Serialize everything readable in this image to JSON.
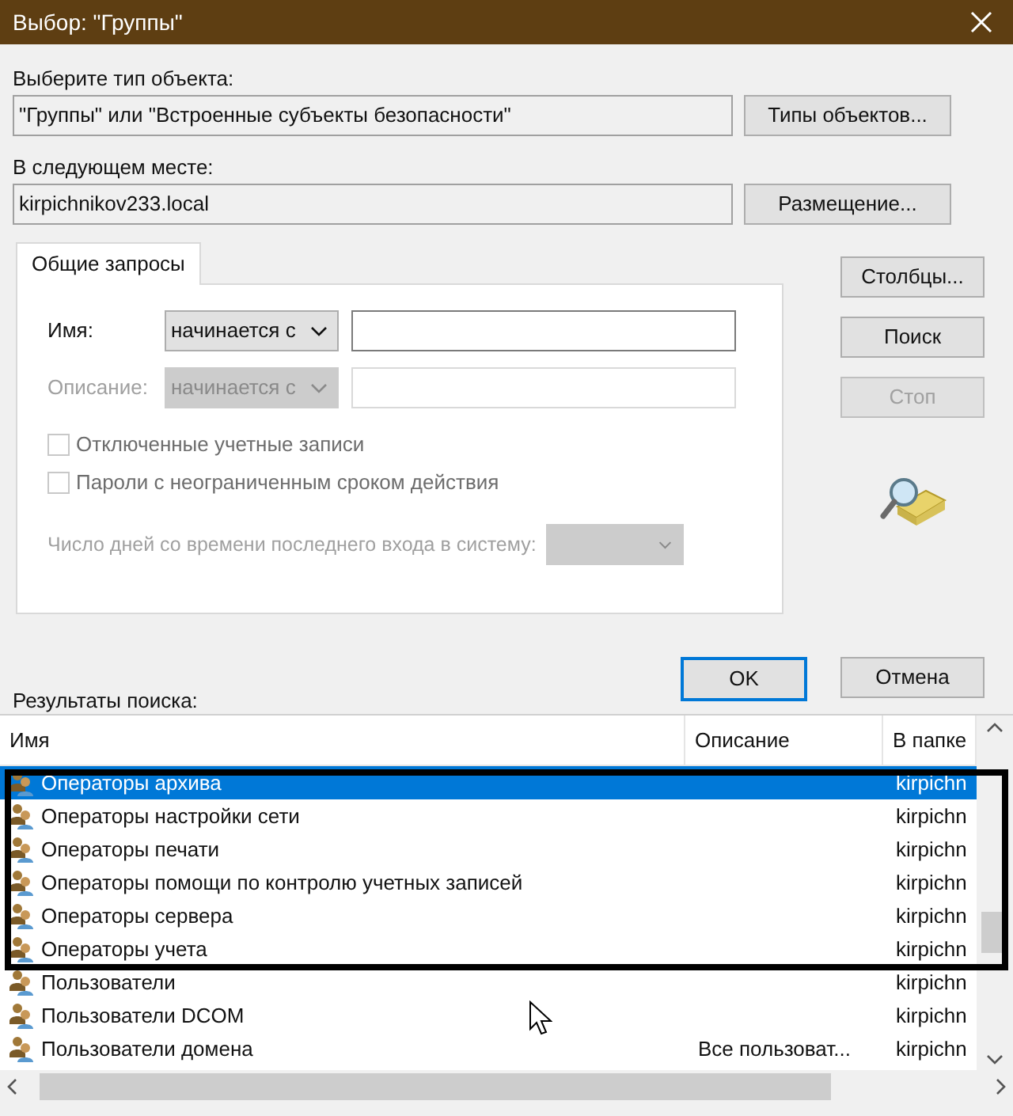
{
  "window": {
    "title": "Выбор: \"Группы\""
  },
  "object_type": {
    "label": "Выберите тип объекта:",
    "value": "\"Группы\" или \"Встроенные субъекты безопасности\"",
    "button": "Типы объектов..."
  },
  "location": {
    "label": "В следующем месте:",
    "value": "kirpichnikov233.local",
    "button": "Размещение..."
  },
  "tabs": [
    {
      "label": "Общие запросы",
      "selected": true
    }
  ],
  "query": {
    "name_label": "Имя:",
    "name_mode": "начинается с",
    "name_disabled": false,
    "description_label": "Описание:",
    "description_mode": "начинается с",
    "description_disabled": true,
    "checkboxes": [
      {
        "label": "Отключенные учетные записи",
        "checked": false,
        "disabled": true
      },
      {
        "label": "Пароли с неограниченным сроком действия",
        "checked": false,
        "disabled": true
      }
    ],
    "days_label": "Число дней со времени последнего входа в систему:"
  },
  "side_buttons": [
    {
      "label": "Столбцы...",
      "disabled": false
    },
    {
      "label": "Поиск",
      "disabled": false
    },
    {
      "label": "Стоп",
      "disabled": true
    }
  ],
  "buttons": [
    {
      "label": "OK",
      "default": true
    },
    {
      "label": "Отмена",
      "default": false
    }
  ],
  "results": {
    "label": "Результаты поиска:",
    "columns": [
      "Имя",
      "Описание",
      "В папке"
    ],
    "rows": [
      {
        "name": "Операторы архива",
        "description": "",
        "folder": "kirpichn",
        "selected": true
      },
      {
        "name": "Операторы настройки сети",
        "description": "",
        "folder": "kirpichn",
        "selected": false
      },
      {
        "name": "Операторы печати",
        "description": "",
        "folder": "kirpichn",
        "selected": false
      },
      {
        "name": "Операторы помощи по контролю учетных записей",
        "description": "",
        "folder": "kirpichn",
        "selected": false
      },
      {
        "name": "Операторы сервера",
        "description": "",
        "folder": "kirpichn",
        "selected": false
      },
      {
        "name": "Операторы учета",
        "description": "",
        "folder": "kirpichn",
        "selected": false
      },
      {
        "name": "Пользователи",
        "description": "",
        "folder": "kirpichn",
        "selected": false
      },
      {
        "name": "Пользователи DCOM",
        "description": "",
        "folder": "kirpichn",
        "selected": false
      },
      {
        "name": "Пользователи домена",
        "description": "Все пользоват...",
        "folder": "kirpichn",
        "selected": false
      }
    ]
  }
}
